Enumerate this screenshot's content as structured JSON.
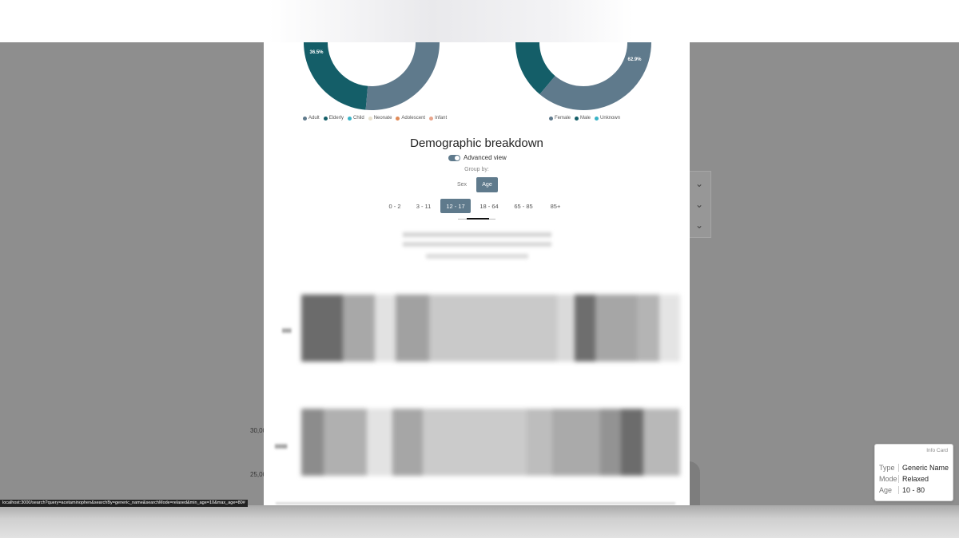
{
  "browser": {
    "status_url": "localhost:3000/search?query=acetaminophen&searchBy=generic_name&searchMode=relaxed&min_age=10&max_age=80#"
  },
  "background": {
    "y_ticks": [
      "30,000",
      "25,000"
    ]
  },
  "donut_left": {
    "label_a": "36.5%",
    "colors": [
      "#5f7a8c",
      "#145e68"
    ],
    "legend": [
      {
        "label": "Adult",
        "color": "#5f7a8c"
      },
      {
        "label": "Elderly",
        "color": "#145e68"
      },
      {
        "label": "Child",
        "color": "#39b3c6"
      },
      {
        "label": "Neonate",
        "color": "#e9e2cf"
      },
      {
        "label": "Adolescent",
        "color": "#e08a57"
      },
      {
        "label": "Infant",
        "color": "#e9a58c"
      }
    ]
  },
  "donut_right": {
    "label_a": "62.9%",
    "legend": [
      {
        "label": "Female",
        "color": "#5f7a8c"
      },
      {
        "label": "Male",
        "color": "#145e68"
      },
      {
        "label": "Unknown",
        "color": "#39b3c6"
      }
    ]
  },
  "breakdown": {
    "title": "Demographic breakdown",
    "advanced_view_label": "Advanced view",
    "group_by_label": "Group by:",
    "group_options": [
      {
        "label": "Sex",
        "selected": false
      },
      {
        "label": "Age",
        "selected": true
      }
    ],
    "age_tabs": [
      {
        "label": "0 - 2",
        "selected": false
      },
      {
        "label": "3 - 11",
        "selected": false
      },
      {
        "label": "12 - 17",
        "selected": true
      },
      {
        "label": "18 - 64",
        "selected": false
      },
      {
        "label": "65 - 85",
        "selected": false
      },
      {
        "label": "85+",
        "selected": false
      }
    ]
  },
  "info_card": {
    "title": "Info Card",
    "rows": [
      {
        "key": "Type",
        "value": "Generic Name"
      },
      {
        "key": "Mode",
        "value": "Relaxed"
      },
      {
        "key": "Age",
        "value": "10 - 80"
      }
    ]
  }
}
